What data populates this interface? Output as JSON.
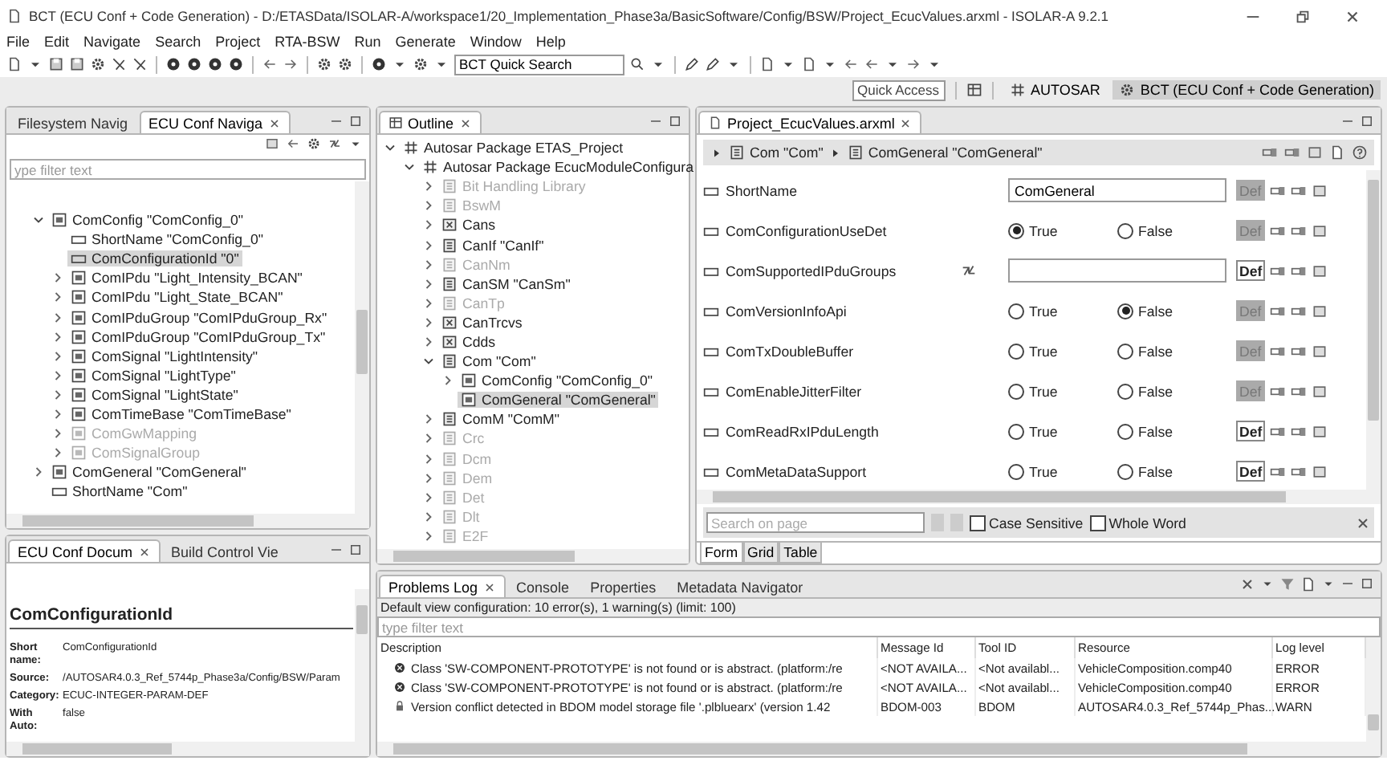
{
  "window": {
    "title": "BCT (ECU Conf + Code Generation) - D:/ETASData/ISOLAR-A/workspace1/20_Implementation_Phase3a/BasicSoftware/Config/BSW/Project_EcucValues.arxml - ISOLAR-A 9.2.1"
  },
  "menu": [
    "File",
    "Edit",
    "Navigate",
    "Search",
    "Project",
    "RTA-BSW",
    "Run",
    "Generate",
    "Window",
    "Help"
  ],
  "toolbar": {
    "search": {
      "value": "BCT Quick Search"
    }
  },
  "perspectives": {
    "quick_access": {
      "placeholder": "Quick Access"
    },
    "items": [
      {
        "label": "AUTOSAR",
        "selected": false
      },
      {
        "label": "BCT (ECU Conf + Code Generation)",
        "selected": true
      }
    ]
  },
  "navigator": {
    "tabs": [
      {
        "label": "Filesystem Navig",
        "selected": false
      },
      {
        "label": "ECU Conf Naviga",
        "selected": true
      }
    ],
    "filter": {
      "placeholder": "ype filter text"
    },
    "tree": [
      {
        "label": "ComConfig \"ComConfig_0\"",
        "kind": "container",
        "expanded": true,
        "selected": false,
        "disabled": false,
        "children": [
          {
            "label": "ShortName \"ComConfig_0\"",
            "kind": "param",
            "selected": false,
            "disabled": false
          },
          {
            "label": "ComConfigurationId \"0\"",
            "kind": "param",
            "selected": true,
            "disabled": false
          },
          {
            "label": "ComIPdu \"Light_Intensity_BCAN\"",
            "kind": "container",
            "expanded": false,
            "selected": false,
            "disabled": false
          },
          {
            "label": "ComIPdu \"Light_State_BCAN\"",
            "kind": "container",
            "expanded": false,
            "selected": false,
            "disabled": false
          },
          {
            "label": "ComIPduGroup \"ComIPduGroup_Rx\"",
            "kind": "container",
            "expanded": false,
            "selected": false,
            "disabled": false
          },
          {
            "label": "ComIPduGroup \"ComIPduGroup_Tx\"",
            "kind": "container",
            "expanded": false,
            "selected": false,
            "disabled": false
          },
          {
            "label": "ComSignal \"LightIntensity\"",
            "kind": "container",
            "expanded": false,
            "selected": false,
            "disabled": false
          },
          {
            "label": "ComSignal \"LightType\"",
            "kind": "container",
            "expanded": false,
            "selected": false,
            "disabled": false
          },
          {
            "label": "ComSignal \"LightState\"",
            "kind": "container",
            "expanded": false,
            "selected": false,
            "disabled": false
          },
          {
            "label": "ComTimeBase \"ComTimeBase\"",
            "kind": "container",
            "expanded": false,
            "selected": false,
            "disabled": false
          },
          {
            "label": "ComGwMapping",
            "kind": "container",
            "expanded": false,
            "selected": false,
            "disabled": true
          },
          {
            "label": "ComSignalGroup",
            "kind": "container",
            "expanded": false,
            "selected": false,
            "disabled": true
          }
        ]
      },
      {
        "label": "ComGeneral \"ComGeneral\"",
        "kind": "container",
        "expanded": false,
        "selected": false,
        "disabled": false
      },
      {
        "label": "ShortName \"Com\"",
        "kind": "param",
        "selected": false,
        "disabled": false
      }
    ]
  },
  "documentation": {
    "tabs": [
      {
        "label": "ECU Conf Docum",
        "selected": true
      },
      {
        "label": "Build Control Vie",
        "selected": false
      }
    ],
    "heading": "ComConfigurationId",
    "fields": [
      {
        "label": "Short name:",
        "value": "ComConfigurationId"
      },
      {
        "label": "Source:",
        "value": "/AUTOSAR4.0.3_Ref_5744p_Phase3a/Config/BSW/Param"
      },
      {
        "label": "Category:",
        "value": "ECUC-INTEGER-PARAM-DEF"
      },
      {
        "label": "With Auto:",
        "value": "false"
      }
    ]
  },
  "outline": {
    "tab": "Outline",
    "tree": [
      {
        "label": "Autosar Package ETAS_Project",
        "kind": "package",
        "expanded": true,
        "selected": false,
        "disabled": false,
        "children": [
          {
            "label": "Autosar Package EcucModuleConfigura",
            "kind": "package",
            "expanded": true,
            "selected": false,
            "disabled": false,
            "children": [
              {
                "label": "Bit Handling Library",
                "kind": "module",
                "expanded": false,
                "selected": false,
                "disabled": true
              },
              {
                "label": "BswM",
                "kind": "module",
                "expanded": false,
                "selected": false,
                "disabled": true
              },
              {
                "label": "Cans",
                "kind": "group",
                "expanded": false,
                "selected": false,
                "disabled": false
              },
              {
                "label": "CanIf \"CanIf\"",
                "kind": "module",
                "expanded": false,
                "selected": false,
                "disabled": false
              },
              {
                "label": "CanNm",
                "kind": "module",
                "expanded": false,
                "selected": false,
                "disabled": true
              },
              {
                "label": "CanSM \"CanSm\"",
                "kind": "module",
                "expanded": false,
                "selected": false,
                "disabled": false
              },
              {
                "label": "CanTp",
                "kind": "module",
                "expanded": false,
                "selected": false,
                "disabled": true
              },
              {
                "label": "CanTrcvs",
                "kind": "group",
                "expanded": false,
                "selected": false,
                "disabled": false
              },
              {
                "label": "Cdds",
                "kind": "group",
                "expanded": false,
                "selected": false,
                "disabled": false
              },
              {
                "label": "Com \"Com\"",
                "kind": "module",
                "expanded": true,
                "selected": false,
                "disabled": false,
                "children": [
                  {
                    "label": "ComConfig \"ComConfig_0\"",
                    "kind": "container",
                    "expanded": false,
                    "selected": false,
                    "disabled": false
                  },
                  {
                    "label": "ComGeneral \"ComGeneral\"",
                    "kind": "container",
                    "selected": true,
                    "disabled": false
                  }
                ]
              },
              {
                "label": "ComM \"ComM\"",
                "kind": "module",
                "expanded": false,
                "selected": false,
                "disabled": false
              },
              {
                "label": "Crc",
                "kind": "module",
                "expanded": false,
                "selected": false,
                "disabled": true
              },
              {
                "label": "Dcm",
                "kind": "module",
                "expanded": false,
                "selected": false,
                "disabled": true
              },
              {
                "label": "Dem",
                "kind": "module",
                "expanded": false,
                "selected": false,
                "disabled": true
              },
              {
                "label": "Det",
                "kind": "module",
                "expanded": false,
                "selected": false,
                "disabled": true
              },
              {
                "label": "Dlt",
                "kind": "module",
                "expanded": false,
                "selected": false,
                "disabled": true
              },
              {
                "label": "E2F",
                "kind": "module",
                "expanded": false,
                "selected": false,
                "disabled": true
              }
            ]
          }
        ]
      }
    ]
  },
  "editor": {
    "tab": "Project_EcucValues.arxml",
    "breadcrumb": [
      "Com \"Com\"",
      "ComGeneral \"ComGeneral\""
    ],
    "rows": [
      {
        "name": "ShortName",
        "kind": "text",
        "value": "ComGeneral",
        "def_button": {
          "label": "Def",
          "shaded": true
        }
      },
      {
        "name": "ComConfigurationUseDet",
        "kind": "bool",
        "options": [
          {
            "label": "True",
            "selected": true
          },
          {
            "label": "False",
            "selected": false
          }
        ],
        "def_button": {
          "label": "Def",
          "shaded": true
        }
      },
      {
        "name": "ComSupportedIPduGroups",
        "kind": "reference",
        "def_button": {
          "label": "Def",
          "shaded": false
        }
      },
      {
        "name": "ComVersionInfoApi",
        "kind": "bool",
        "options": [
          {
            "label": "True",
            "selected": false
          },
          {
            "label": "False",
            "selected": true
          }
        ],
        "def_button": {
          "label": "Def",
          "shaded": true
        }
      },
      {
        "name": "ComTxDoubleBuffer",
        "kind": "bool",
        "options": [
          {
            "label": "True",
            "selected": false
          },
          {
            "label": "False",
            "selected": false
          }
        ],
        "def_button": {
          "label": "Def",
          "shaded": true
        }
      },
      {
        "name": "ComEnableJitterFilter",
        "kind": "bool",
        "options": [
          {
            "label": "True",
            "selected": false
          },
          {
            "label": "False",
            "selected": false
          }
        ],
        "def_button": {
          "label": "Def",
          "shaded": true
        }
      },
      {
        "name": "ComReadRxIPduLength",
        "kind": "bool",
        "options": [
          {
            "label": "True",
            "selected": false
          },
          {
            "label": "False",
            "selected": false
          }
        ],
        "def_button": {
          "label": "Def",
          "shaded": false
        }
      },
      {
        "name": "ComMetaDataSupport",
        "kind": "bool",
        "options": [
          {
            "label": "True",
            "selected": false
          },
          {
            "label": "False",
            "selected": false
          }
        ],
        "def_button": {
          "label": "Def",
          "shaded": false
        }
      }
    ],
    "page_search": {
      "placeholder": "Search on page",
      "options": [
        {
          "label": "Case Sensitive",
          "checked": false
        },
        {
          "label": "Whole Word",
          "checked": false
        }
      ]
    },
    "view_tabs": [
      {
        "label": "Form",
        "selected": true
      },
      {
        "label": "Grid",
        "selected": false
      },
      {
        "label": "Table",
        "selected": false
      }
    ]
  },
  "problems": {
    "tabs": [
      {
        "label": "Problems Log",
        "selected": true
      },
      {
        "label": "Console",
        "selected": false
      },
      {
        "label": "Properties",
        "selected": false
      },
      {
        "label": "Metadata Navigator",
        "selected": false
      }
    ],
    "summary": "Default view configuration: 10 error(s), 1 warning(s) (limit: 100)",
    "filter": {
      "placeholder": "type filter text"
    },
    "columns": [
      "Description",
      "Message Id",
      "Tool ID",
      "Resource",
      "Log level"
    ],
    "rows": [
      {
        "kind": "error",
        "cells": [
          "Class 'SW-COMPONENT-PROTOTYPE' is not found or is abstract. (platform:/re",
          "<NOT AVAILA...",
          "<Not availabl...",
          "VehicleComposition.comp40",
          "ERROR"
        ]
      },
      {
        "kind": "error",
        "cells": [
          "Class 'SW-COMPONENT-PROTOTYPE' is not found or is abstract. (platform:/re",
          "<NOT AVAILA...",
          "<Not availabl...",
          "VehicleComposition.comp40",
          "ERROR"
        ]
      },
      {
        "kind": "warning",
        "cells": [
          "Version conflict detected in BDOM model storage file '.plbluearx' (version 1.42",
          "BDOM-003",
          "BDOM",
          "AUTOSAR4.0.3_Ref_5744p_Phas...",
          "WARN"
        ]
      }
    ]
  }
}
